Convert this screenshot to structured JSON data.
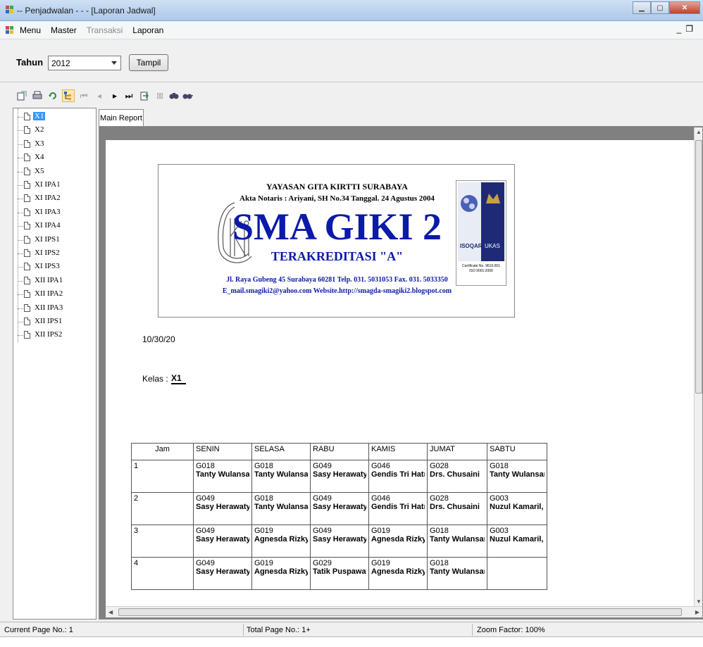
{
  "window": {
    "title": "-- Penjadwalan - - - [Laporan Jadwal]"
  },
  "menu": {
    "items": [
      "Menu",
      "Master",
      "Transaksi",
      "Laporan"
    ],
    "disabled": [
      false,
      false,
      true,
      false
    ]
  },
  "filter": {
    "label": "Tahun",
    "year": "2012",
    "button": "Tampil"
  },
  "tree": {
    "items": [
      "X1",
      "X2",
      "X3",
      "X4",
      "X5",
      "XI IPA1",
      "XI IPA2",
      "XI IPA3",
      "XI IPA4",
      "XI IPS1",
      "XI IPS2",
      "XI IPS3",
      "XII IPA1",
      "XII IPA2",
      "XII IPA3",
      "XII IPS1",
      "XII IPS2"
    ],
    "selected": "X1"
  },
  "report": {
    "tab": "Main Report",
    "letterhead": {
      "foundation": "YAYASAN GITA KIRTTI SURABAYA",
      "notary": "Akta Notaris : Ariyani, SH No.34 Tanggal. 24 Agustus 2004",
      "school": "SMA GIKI 2",
      "accreditation": "TERAKREDITASI \"A\"",
      "address": "Jl. Raya Gubeng 45 Surabaya 60281 Telp. 031. 5031053 Fax. 031. 5033350",
      "contact": "E_mail.smagiki2@yahoo.com Website.http://smagda-smagiki2.blogspot.com",
      "cert_left": "ISOQAR",
      "cert_right": "UKAS",
      "cert_no": "Certificate No. 9610.001",
      "cert_iso": "ISO 9001:2000"
    },
    "date": "10/30/20",
    "kelas_label": "Kelas :",
    "kelas_value": "X1",
    "table": {
      "headers": [
        "Jam",
        "SENIN",
        "SELASA",
        "RABU",
        "KAMIS",
        "JUMAT",
        "SABTU"
      ],
      "rows": [
        {
          "jam": "1",
          "cells": [
            [
              "G018",
              "Tanty Wulansar"
            ],
            [
              "G018",
              "Tanty Wulansar"
            ],
            [
              "G049",
              "Sasy Herawaty,"
            ],
            [
              "G046",
              "Gendis Tri Hatn"
            ],
            [
              "G028",
              "Drs. Chusaini"
            ],
            [
              "G018",
              "Tanty Wulansar"
            ]
          ]
        },
        {
          "jam": "2",
          "cells": [
            [
              "G049",
              "Sasy Herawaty,"
            ],
            [
              "G018",
              "Tanty Wulansar"
            ],
            [
              "G049",
              "Sasy Herawaty,"
            ],
            [
              "G046",
              "Gendis Tri Hatn"
            ],
            [
              "G028",
              "Drs. Chusaini"
            ],
            [
              "G003",
              "Nuzul Kamaril,"
            ]
          ]
        },
        {
          "jam": "3",
          "cells": [
            [
              "G049",
              "Sasy Herawaty,"
            ],
            [
              "G019",
              "Agnesda Rizky"
            ],
            [
              "G049",
              "Sasy Herawaty,"
            ],
            [
              "G019",
              "Agnesda Rizky"
            ],
            [
              "G018",
              "Tanty Wulansar"
            ],
            [
              "G003",
              "Nuzul Kamaril,"
            ]
          ]
        },
        {
          "jam": "4",
          "cells": [
            [
              "G049",
              "Sasy Herawaty,"
            ],
            [
              "G019",
              "Agnesda Rizky"
            ],
            [
              "G029",
              "Tatik Puspawati"
            ],
            [
              "G019",
              "Agnesda Rizky"
            ],
            [
              "G018",
              "Tanty Wulansar"
            ],
            [
              "",
              ""
            ]
          ]
        }
      ]
    }
  },
  "status": {
    "current_page": "Current Page No.: 1",
    "total_page": "Total Page No.: 1+",
    "zoom": "Zoom Factor: 100%"
  }
}
